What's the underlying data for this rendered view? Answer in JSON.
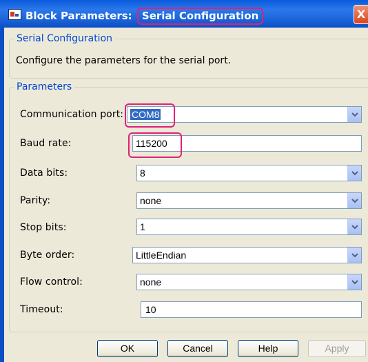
{
  "window": {
    "title_prefix": "Block Parameters:",
    "title_block": "Serial Configuration",
    "close_glyph": "X",
    "highlight_color": "#e0207a",
    "titlebar_color": "#0a5bdc"
  },
  "description_group": {
    "legend": "Serial Configuration",
    "text": "Configure the parameters for the serial port."
  },
  "parameters_group": {
    "legend": "Parameters",
    "fields": [
      {
        "label": "Communication port:",
        "value": "COM8",
        "type": "dropdown",
        "selected": true
      },
      {
        "label": "Baud rate:",
        "value": "115200",
        "type": "text"
      },
      {
        "label": "Data bits:",
        "value": "8",
        "type": "dropdown"
      },
      {
        "label": "Parity:",
        "value": "none",
        "type": "dropdown"
      },
      {
        "label": "Stop bits:",
        "value": "1",
        "type": "dropdown"
      },
      {
        "label": "Byte order:",
        "value": "LittleEndian",
        "type": "dropdown"
      },
      {
        "label": "Flow control:",
        "value": "none",
        "type": "dropdown"
      },
      {
        "label": "Timeout:",
        "value": "10",
        "type": "text"
      }
    ]
  },
  "buttons": {
    "ok": "OK",
    "cancel": "Cancel",
    "help": "Help",
    "apply": "Apply"
  },
  "icons": {
    "app": "block-parameters-icon",
    "close": "close-icon",
    "dropdown": "chevron-down-icon"
  }
}
